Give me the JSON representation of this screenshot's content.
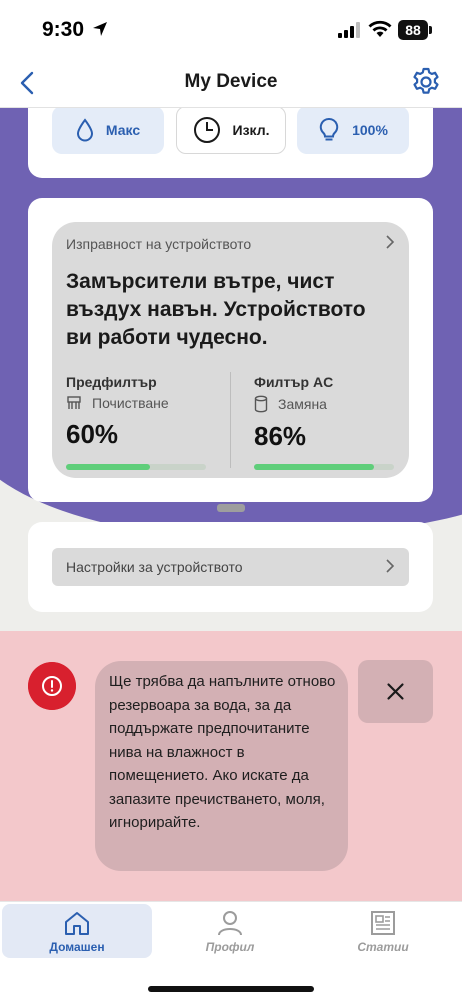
{
  "status_bar": {
    "time": "9:30",
    "battery": "88"
  },
  "header": {
    "title": "My Device",
    "back_icon": "chevron-left-icon",
    "settings_icon": "gear-icon"
  },
  "modes": [
    {
      "icon": "water-drop-icon",
      "label": "Макс"
    },
    {
      "icon": "clock-icon",
      "label": "Изкл."
    },
    {
      "icon": "lightbulb-icon",
      "label": "100%"
    }
  ],
  "health": {
    "title": "Изправност на устройството",
    "message": "Замърсители вътре, чист въздух навън. Устройството ви работи чудесно.",
    "filters": [
      {
        "name": "Предфилтър",
        "status": "Почистване",
        "percent_text": "60%",
        "percent": 0.6,
        "icon": "brush-icon"
      },
      {
        "name": "Филтър AC",
        "status": "Замяна",
        "percent_text": "86%",
        "percent": 0.86,
        "icon": "cylinder-filter-icon"
      }
    ]
  },
  "settings": {
    "label": "Настройки за устройството"
  },
  "alert": {
    "icon": "exclamation-circle-icon",
    "message": "Ще трябва да напълните отново резервоара за вода, за да поддържате предпочитаните нива на влажност в помещението. Ако искате да запазите пречистването, моля, игнорирайте.",
    "close_icon": "close-icon"
  },
  "nav": [
    {
      "label": "Домашен",
      "icon": "home-icon",
      "active": true
    },
    {
      "label": "Профил",
      "icon": "person-icon",
      "active": false
    },
    {
      "label": "Статии",
      "icon": "newspaper-icon",
      "active": false
    }
  ],
  "colors": {
    "accent": "#2b5fb0",
    "purple": "#6f62b3",
    "progress": "#5fce7a",
    "alert_bg": "#f3c8cb",
    "alert_icon": "#d8202e"
  }
}
